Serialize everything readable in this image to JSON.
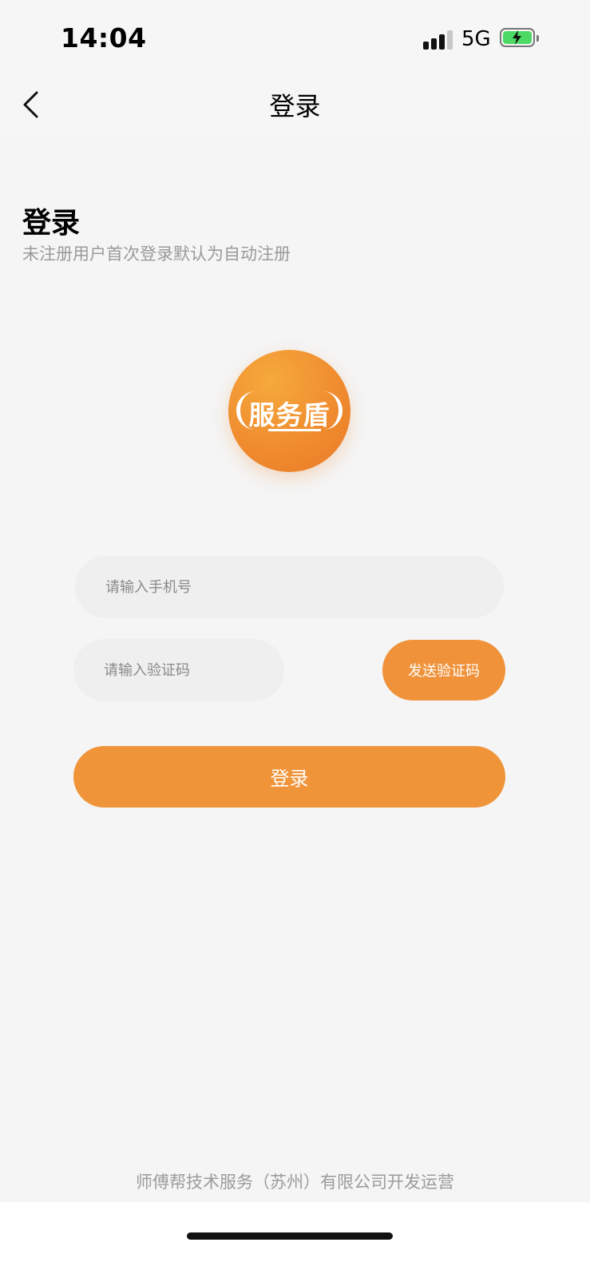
{
  "status_bar": {
    "time": "14:04",
    "network": "5G",
    "battery_icon": "battery-charging-icon",
    "signal_icon": "signal-bars-icon"
  },
  "nav": {
    "title": "登录",
    "back_icon": "chevron-left-icon"
  },
  "header": {
    "title": "登录",
    "subtitle": "未注册用户首次登录默认为自动注册"
  },
  "logo": {
    "text": "服务盾"
  },
  "form": {
    "phone_placeholder": "请输入手机号",
    "phone_value": "",
    "code_placeholder": "请输入验证码",
    "code_value": "",
    "send_code_label": "发送验证码",
    "login_label": "登录"
  },
  "footer": {
    "text": "师傅帮技术服务（苏州）有限公司开发运营"
  },
  "colors": {
    "accent": "#f0943a",
    "background": "#f5f5f5",
    "input_bg": "#efefef"
  }
}
